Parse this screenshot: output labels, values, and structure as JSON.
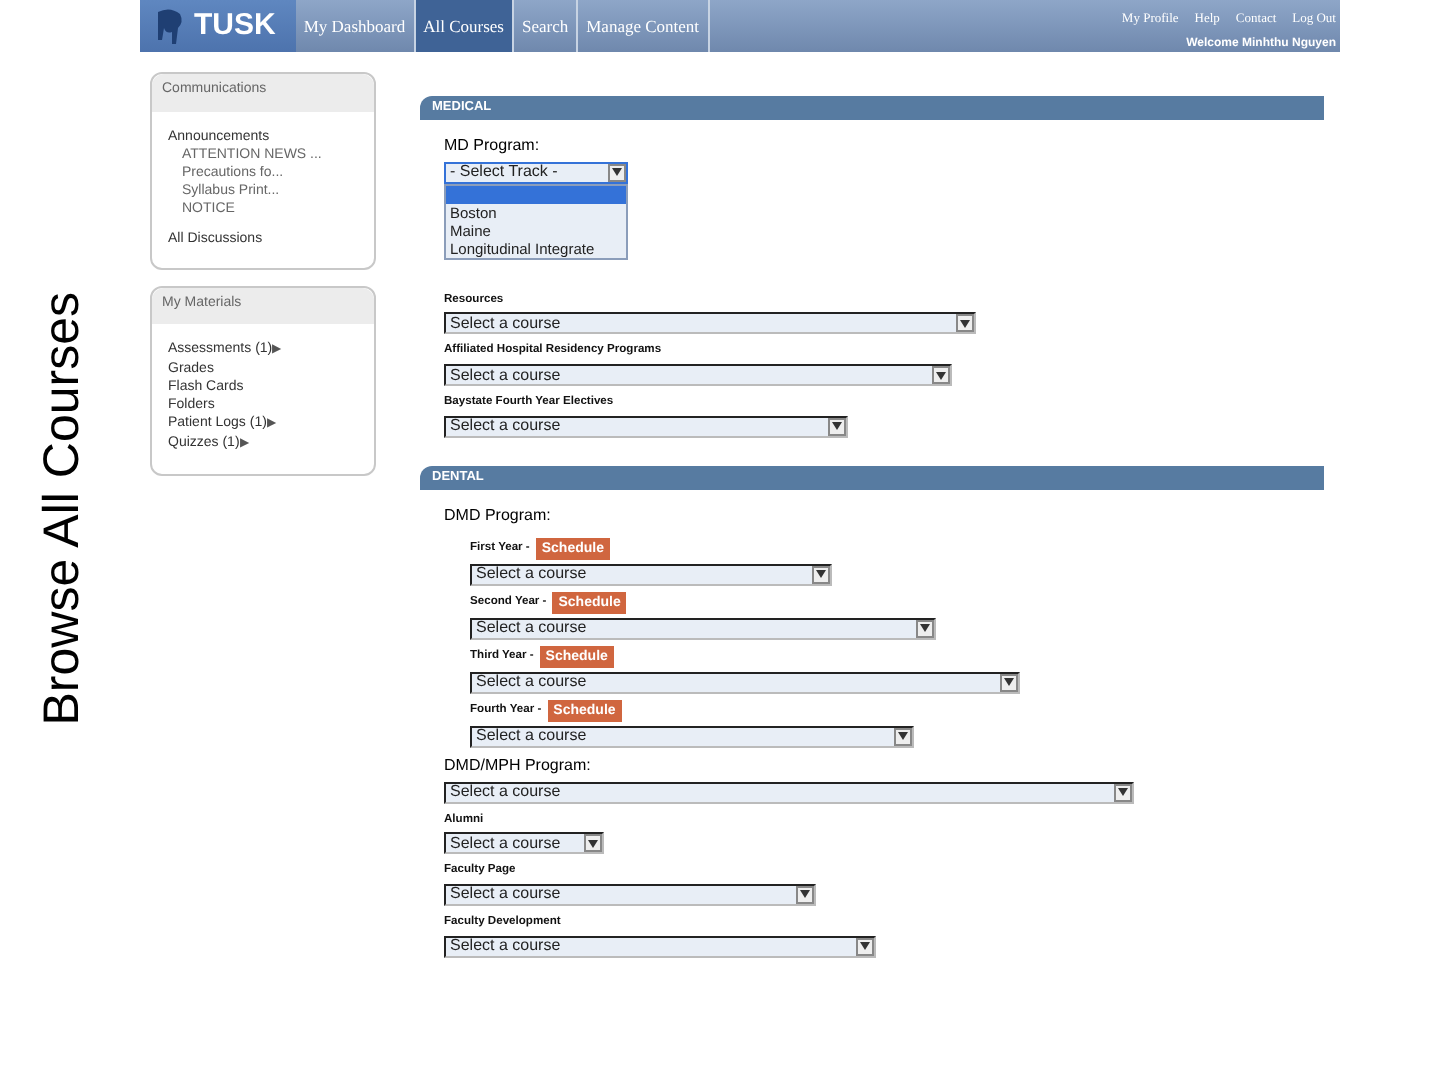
{
  "slide_title": "Browse All Courses",
  "navbar": {
    "logo": "TUSK",
    "tabs": [
      {
        "label": "My Dashboard",
        "selected": false
      },
      {
        "label": "All Courses",
        "selected": true
      },
      {
        "label": "Search",
        "selected": false
      },
      {
        "label": "Manage Content",
        "selected": false
      }
    ],
    "links": [
      "My Profile",
      "Help",
      "Contact",
      "Log Out"
    ],
    "welcome": "Welcome Minhthu Nguyen"
  },
  "sidebar": [
    {
      "title": "Communications",
      "items": [
        {
          "label": "Announcements",
          "children": [
            {
              "label": "ATTENTION NEWS ..."
            },
            {
              "label": "Precautions fo..."
            },
            {
              "label": "Syllabus Print..."
            },
            {
              "label": "NOTICE"
            }
          ]
        },
        {
          "label": "All Discussions"
        }
      ]
    },
    {
      "title": "My Materials",
      "items": [
        {
          "label": "Assessments (1)",
          "arrow": "▶"
        },
        {
          "label": "Grades"
        },
        {
          "label": "Flash Cards"
        },
        {
          "label": "Folders"
        },
        {
          "label": "Patient Logs (1)",
          "arrow": "▶"
        },
        {
          "label": "Quizzes (1)",
          "arrow": "▶"
        }
      ]
    }
  ],
  "sections": [
    {
      "title": "MEDICAL",
      "items": [
        {
          "kind": "program",
          "label": "MD Program:",
          "select": {
            "value": "- Select Track -",
            "open": true,
            "options": [
              {
                "selected": true
              },
              {
                "label": "Boston",
                "selected": false
              },
              {
                "label": "Maine",
                "selected": false
              },
              {
                "label": "Longitudinal Integrate",
                "selected": false
              }
            ]
          }
        },
        {
          "kind": "field",
          "label": "Resources",
          "select": {
            "value": "Select a course"
          }
        },
        {
          "kind": "field",
          "label": "Affiliated Hospital Residency Programs",
          "select": {
            "value": "Select a course"
          }
        },
        {
          "kind": "field",
          "label": "Baystate Fourth Year Electives",
          "select": {
            "value": "Select a course"
          }
        }
      ]
    },
    {
      "title": "DENTAL",
      "items": [
        {
          "kind": "program",
          "label": "DMD Program:"
        },
        {
          "kind": "year",
          "label": "First Year -",
          "button": "Schedule",
          "select": {
            "value": "Select a course"
          }
        },
        {
          "kind": "year",
          "label": "Second Year -",
          "button": "Schedule",
          "select": {
            "value": "Select a course"
          }
        },
        {
          "kind": "year",
          "label": "Third Year -",
          "button": "Schedule",
          "select": {
            "value": "Select a course"
          }
        },
        {
          "kind": "year",
          "label": "Fourth Year -",
          "button": "Schedule",
          "select": {
            "value": "Select a course"
          }
        },
        {
          "kind": "program",
          "label": "DMD/MPH Program:",
          "select": {
            "value": "Select a course"
          }
        },
        {
          "kind": "field",
          "label": "Alumni",
          "select": {
            "value": "Select a course"
          }
        },
        {
          "kind": "field",
          "label": "Faculty Page",
          "select": {
            "value": "Select a course"
          }
        },
        {
          "kind": "field",
          "label": "Faculty Development",
          "select": {
            "value": "Select a course"
          }
        }
      ]
    }
  ]
}
